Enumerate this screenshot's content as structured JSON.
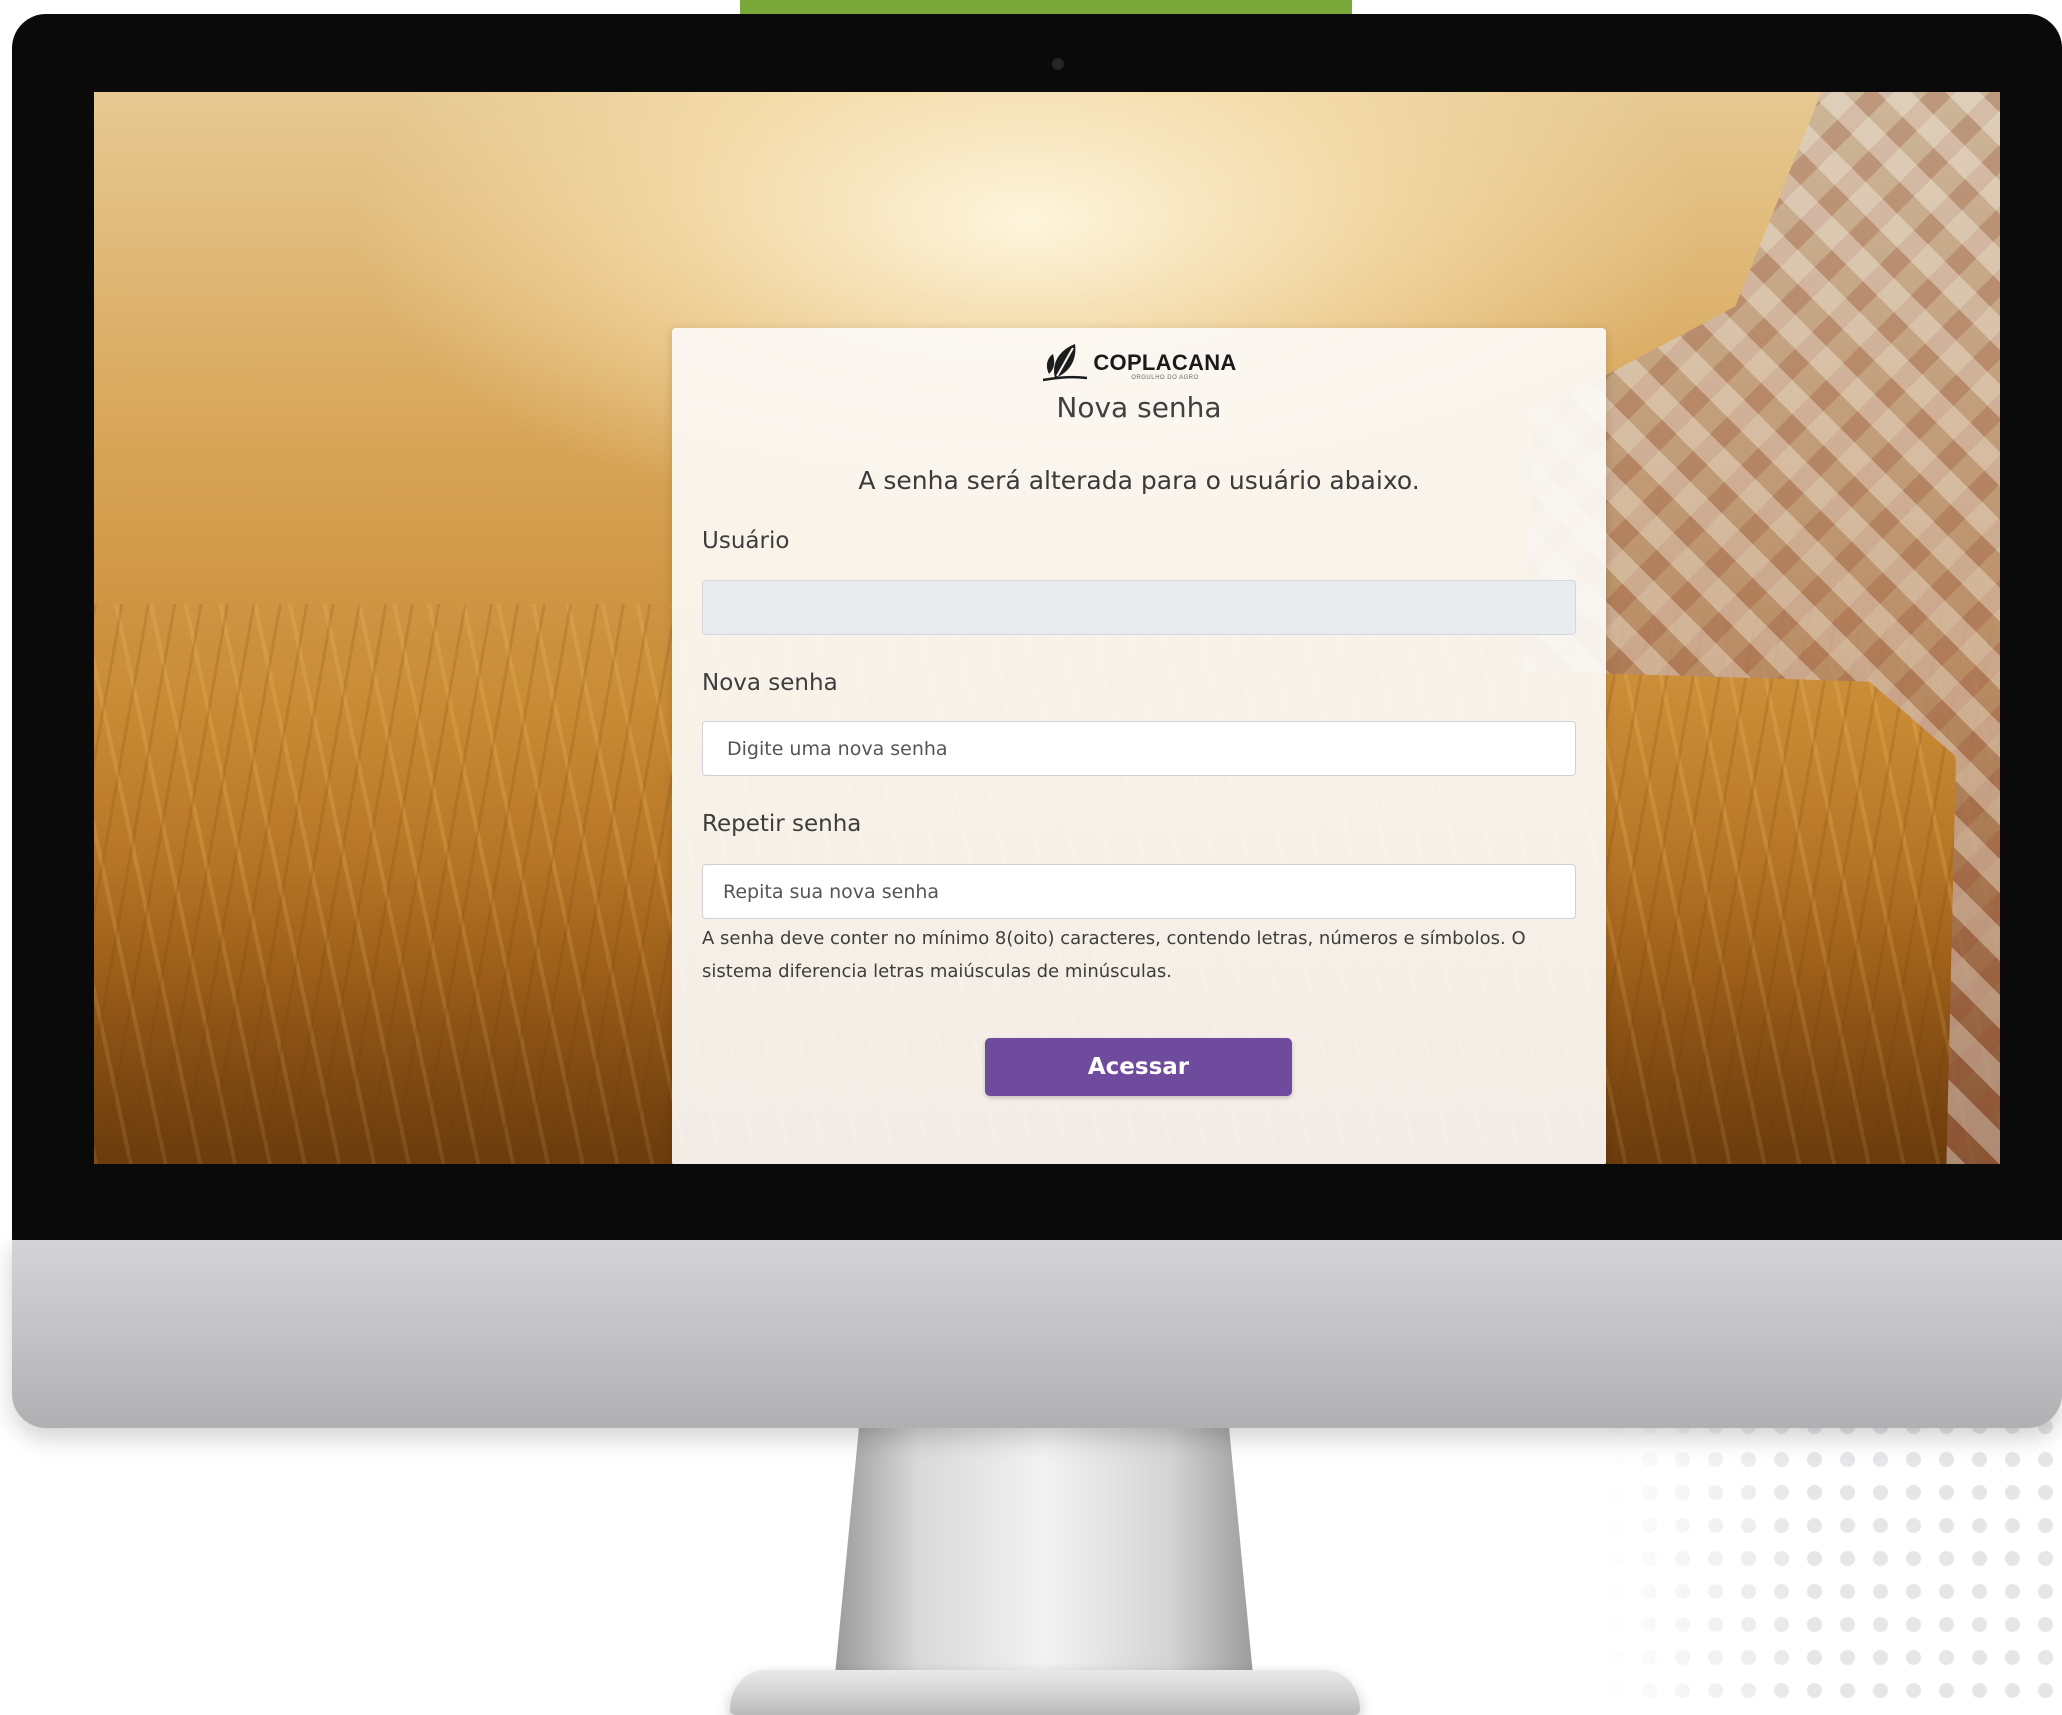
{
  "brand": {
    "name": "COPLACANA",
    "tagline": "ORGULHO DO AGRO",
    "accent_color": "#7aa83a",
    "button_color": "#6f4b9e"
  },
  "card": {
    "title": "Nova senha",
    "subtitle": "A senha será alterada para o usuário abaixo."
  },
  "fields": {
    "user": {
      "label": "Usuário",
      "value": "",
      "placeholder": ""
    },
    "new_password": {
      "label": "Nova senha",
      "placeholder": "Digite uma nova senha"
    },
    "repeat_password": {
      "label": "Repetir senha",
      "placeholder": "Repita sua nova senha"
    }
  },
  "hint": "A senha deve conter no mínimo 8(oito) caracteres, contendo letras, números e símbolos. O sistema diferencia letras maiúsculas de minúsculas.",
  "submit_label": "Acessar",
  "icons": {
    "logo": "leaf-logo-icon",
    "camera": "camera-icon"
  }
}
